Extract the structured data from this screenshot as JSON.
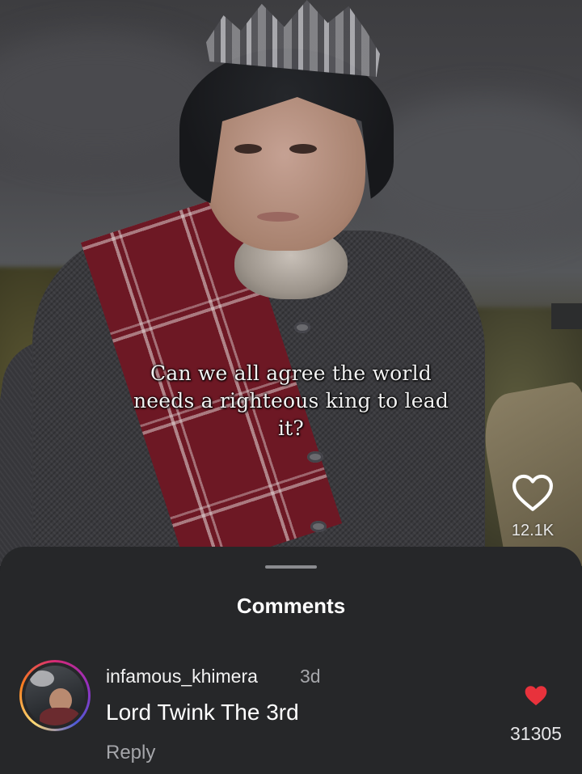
{
  "video": {
    "caption_lines": [
      "Can we all agree the world",
      "needs a righteous king to lead",
      "it?"
    ],
    "like_icon": "heart-outline-icon",
    "like_count": "12.1K"
  },
  "comments_sheet": {
    "title": "Comments",
    "comments": [
      {
        "avatar": "user-avatar",
        "username": "infamous_khimera",
        "age": "3d",
        "text": "Lord Twink The 3rd",
        "reply_label": "Reply",
        "like_icon": "heart-filled-icon",
        "like_count": "31305"
      }
    ]
  },
  "colors": {
    "sheet_bg": "#262729",
    "like_red": "#e8323c",
    "muted_text": "#a5a6aa"
  }
}
